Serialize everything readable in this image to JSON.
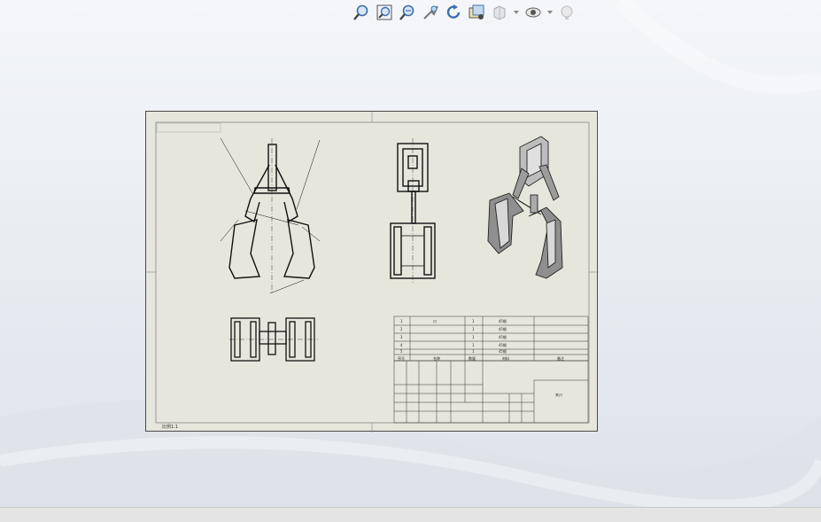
{
  "toolbar": {
    "items": [
      {
        "icon": "zoom-to-fit-icon"
      },
      {
        "icon": "zoom-to-area-icon"
      },
      {
        "icon": "zoom-in-out-icon"
      },
      {
        "icon": "pan-icon"
      },
      {
        "icon": "rotate-icon"
      },
      {
        "icon": "view-orientation-icon"
      },
      {
        "icon": "display-style-icon"
      },
      {
        "icon": "hide-show-items-icon"
      },
      {
        "icon": "edit-appearance-icon"
      }
    ]
  },
  "drawing": {
    "scale_label": "比例1:1",
    "bom_rows": [
      [
        "1",
        "爪",
        "1",
        "45钢"
      ],
      [
        "2",
        "",
        "1",
        "45钢"
      ],
      [
        "3",
        "",
        "1",
        "45钢"
      ],
      [
        "4",
        "",
        "1",
        "45钢"
      ],
      [
        "5",
        "",
        "1",
        "45钢"
      ]
    ],
    "bom_header": [
      "序号",
      "名称",
      "数量",
      "材料",
      "备注"
    ],
    "title_block": {
      "part_name": "夹爪"
    }
  },
  "colors": {
    "paper": "#e6e6dc",
    "line": "#1a1a1a",
    "shade": "#8f8f8f",
    "accent_icon": "#3b6fb0"
  }
}
